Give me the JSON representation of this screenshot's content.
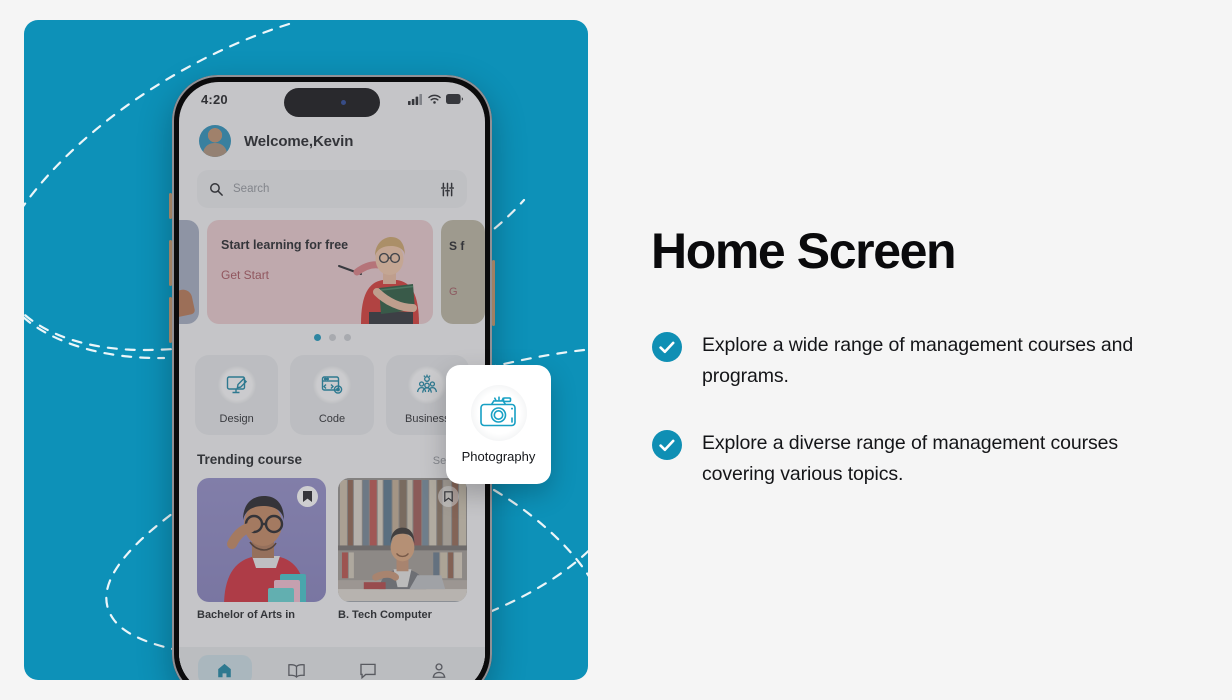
{
  "colors": {
    "teal": "#0d91b8",
    "check_teal": "#0f8fb4",
    "page_bg": "#f5f5f5",
    "banner_pink": "#e8c7ca",
    "banner_cta": "#a24a52"
  },
  "right": {
    "headline": "Home Screen",
    "bullets": [
      "Explore a wide range of management courses and programs.",
      " Explore a diverse range of management courses covering various topics."
    ]
  },
  "phone": {
    "status": {
      "time": "4:20",
      "signal_icon": "cellular-signal-icon",
      "wifi_icon": "wifi-icon",
      "battery_icon": "battery-icon"
    },
    "header": {
      "avatar_icon": "user-avatar",
      "welcome": "Welcome,Kevin"
    },
    "search": {
      "placeholder": "Search",
      "search_icon": "search-icon",
      "filter_icon": "filter-sliders-icon"
    },
    "banner": {
      "title": "Start learning for free",
      "cta": "Get Start",
      "side_title": "S f",
      "side_cta": "G",
      "dots": 3,
      "active_dot": 0
    },
    "categories": [
      {
        "label": "Design",
        "icon": "design-monitor-pen-icon"
      },
      {
        "label": "Code",
        "icon": "code-window-gear-icon"
      },
      {
        "label": "Business",
        "icon": "business-people-icon"
      }
    ],
    "floating_card": {
      "label": "Photography",
      "icon": "camera-icon"
    },
    "trending": {
      "title": "Trending course",
      "see_all": "See All",
      "courses": [
        {
          "name": "Bachelor of Arts in",
          "bookmark": "bookmark-filled-icon"
        },
        {
          "name": "B. Tech Computer",
          "bookmark": "bookmark-outline-icon"
        }
      ]
    },
    "nav": [
      {
        "icon": "home-icon",
        "active": true
      },
      {
        "icon": "book-icon",
        "active": false
      },
      {
        "icon": "chat-icon",
        "active": false
      },
      {
        "icon": "profile-icon",
        "active": false
      }
    ]
  }
}
